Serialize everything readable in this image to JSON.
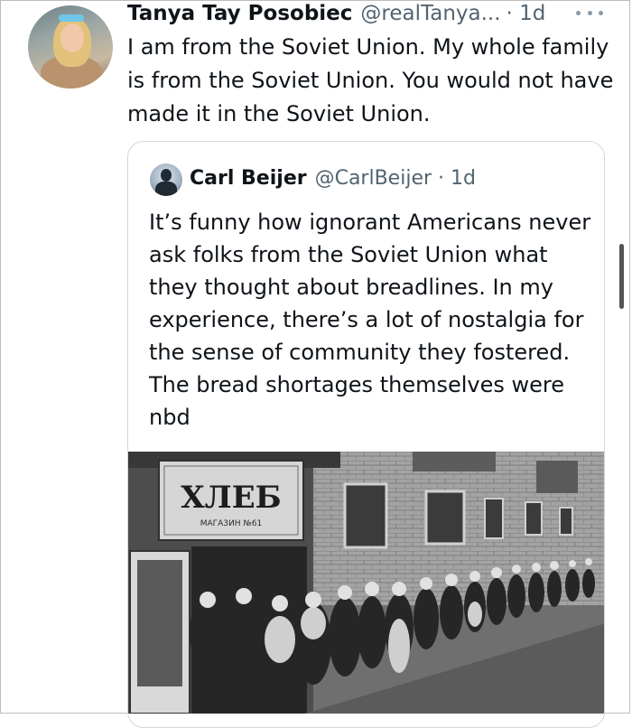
{
  "tweet": {
    "author_name": "Tanya Tay Posobiec",
    "author_handle": "@realTanya...",
    "time": "· 1d",
    "text": "I am from the Soviet Union. My whole family is from the Soviet Union. You would not have made it in the Soviet Union."
  },
  "quoted_tweet": {
    "author_name": "Carl Beijer",
    "author_handle": "@CarlBeijer · 1d",
    "text": "It’s funny how ignorant Americans never ask folks from the Soviet Union what they thought about breadlines. In my experience, there’s a lot of nostalgia for the sense of community they fostered. The bread shortages themselves were nbd",
    "photo": {
      "sign_main": "ХЛЕБ",
      "sign_sub": "МАГАЗИН №61"
    }
  },
  "icons": {
    "more": "more-icon"
  }
}
